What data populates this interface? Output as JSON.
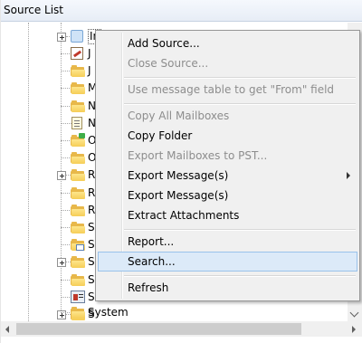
{
  "panel": {
    "title": "Source List"
  },
  "tree": {
    "nodes": [
      {
        "label": "In",
        "icon": "inbox-folder-icon",
        "expander": true
      },
      {
        "label": "J",
        "icon": "journal-icon",
        "expander": false
      },
      {
        "label": "J",
        "icon": "folder-icon",
        "expander": false
      },
      {
        "label": "M",
        "icon": "folder-icon",
        "expander": false
      },
      {
        "label": "N",
        "icon": "folder-icon",
        "expander": false
      },
      {
        "label": "N",
        "icon": "notes-icon",
        "expander": false
      },
      {
        "label": "O",
        "icon": "outbox-icon",
        "expander": false
      },
      {
        "label": "O",
        "icon": "folder-icon",
        "expander": false
      },
      {
        "label": "R",
        "icon": "folder-icon",
        "expander": true
      },
      {
        "label": "R",
        "icon": "folder-icon",
        "expander": false
      },
      {
        "label": "R",
        "icon": "folder-icon",
        "expander": false
      },
      {
        "label": "S",
        "icon": "folder-icon",
        "expander": false
      },
      {
        "label": "S",
        "icon": "sent-items-icon",
        "expander": false
      },
      {
        "label": "S",
        "icon": "folder-icon",
        "expander": true
      },
      {
        "label": "S",
        "icon": "folder-icon",
        "expander": false
      },
      {
        "label": "S",
        "icon": "contacts-icon",
        "expander": false
      },
      {
        "label": "S",
        "icon": "folder-icon",
        "expander": true
      },
      {
        "label": "System",
        "icon": "folder-icon",
        "expander": false
      }
    ]
  },
  "context_menu": {
    "items": [
      {
        "label": "Add Source...",
        "enabled": true
      },
      {
        "label": "Close Source...",
        "enabled": false
      },
      {
        "label": "Use message table to get \"From\" field",
        "enabled": false
      },
      {
        "label": "Copy All Mailboxes",
        "enabled": false
      },
      {
        "label": "Copy Folder",
        "enabled": true
      },
      {
        "label": "Export Mailboxes to PST...",
        "enabled": false
      },
      {
        "label": "Export Message(s)",
        "enabled": true,
        "submenu": true
      },
      {
        "label": "Export Message(s)",
        "enabled": true
      },
      {
        "label": "Extract Attachments",
        "enabled": true
      },
      {
        "label": "Report...",
        "enabled": true
      },
      {
        "label": "Search...",
        "enabled": true,
        "highlighted": true
      },
      {
        "label": "Refresh",
        "enabled": true
      }
    ]
  },
  "colors": {
    "menu_background": "#f0f0f0",
    "menu_highlight": "#dceaf8",
    "menu_highlight_border": "#9ac2ea",
    "disabled_text": "#8d8d8d",
    "folder_yellow": "#f6cd57"
  }
}
